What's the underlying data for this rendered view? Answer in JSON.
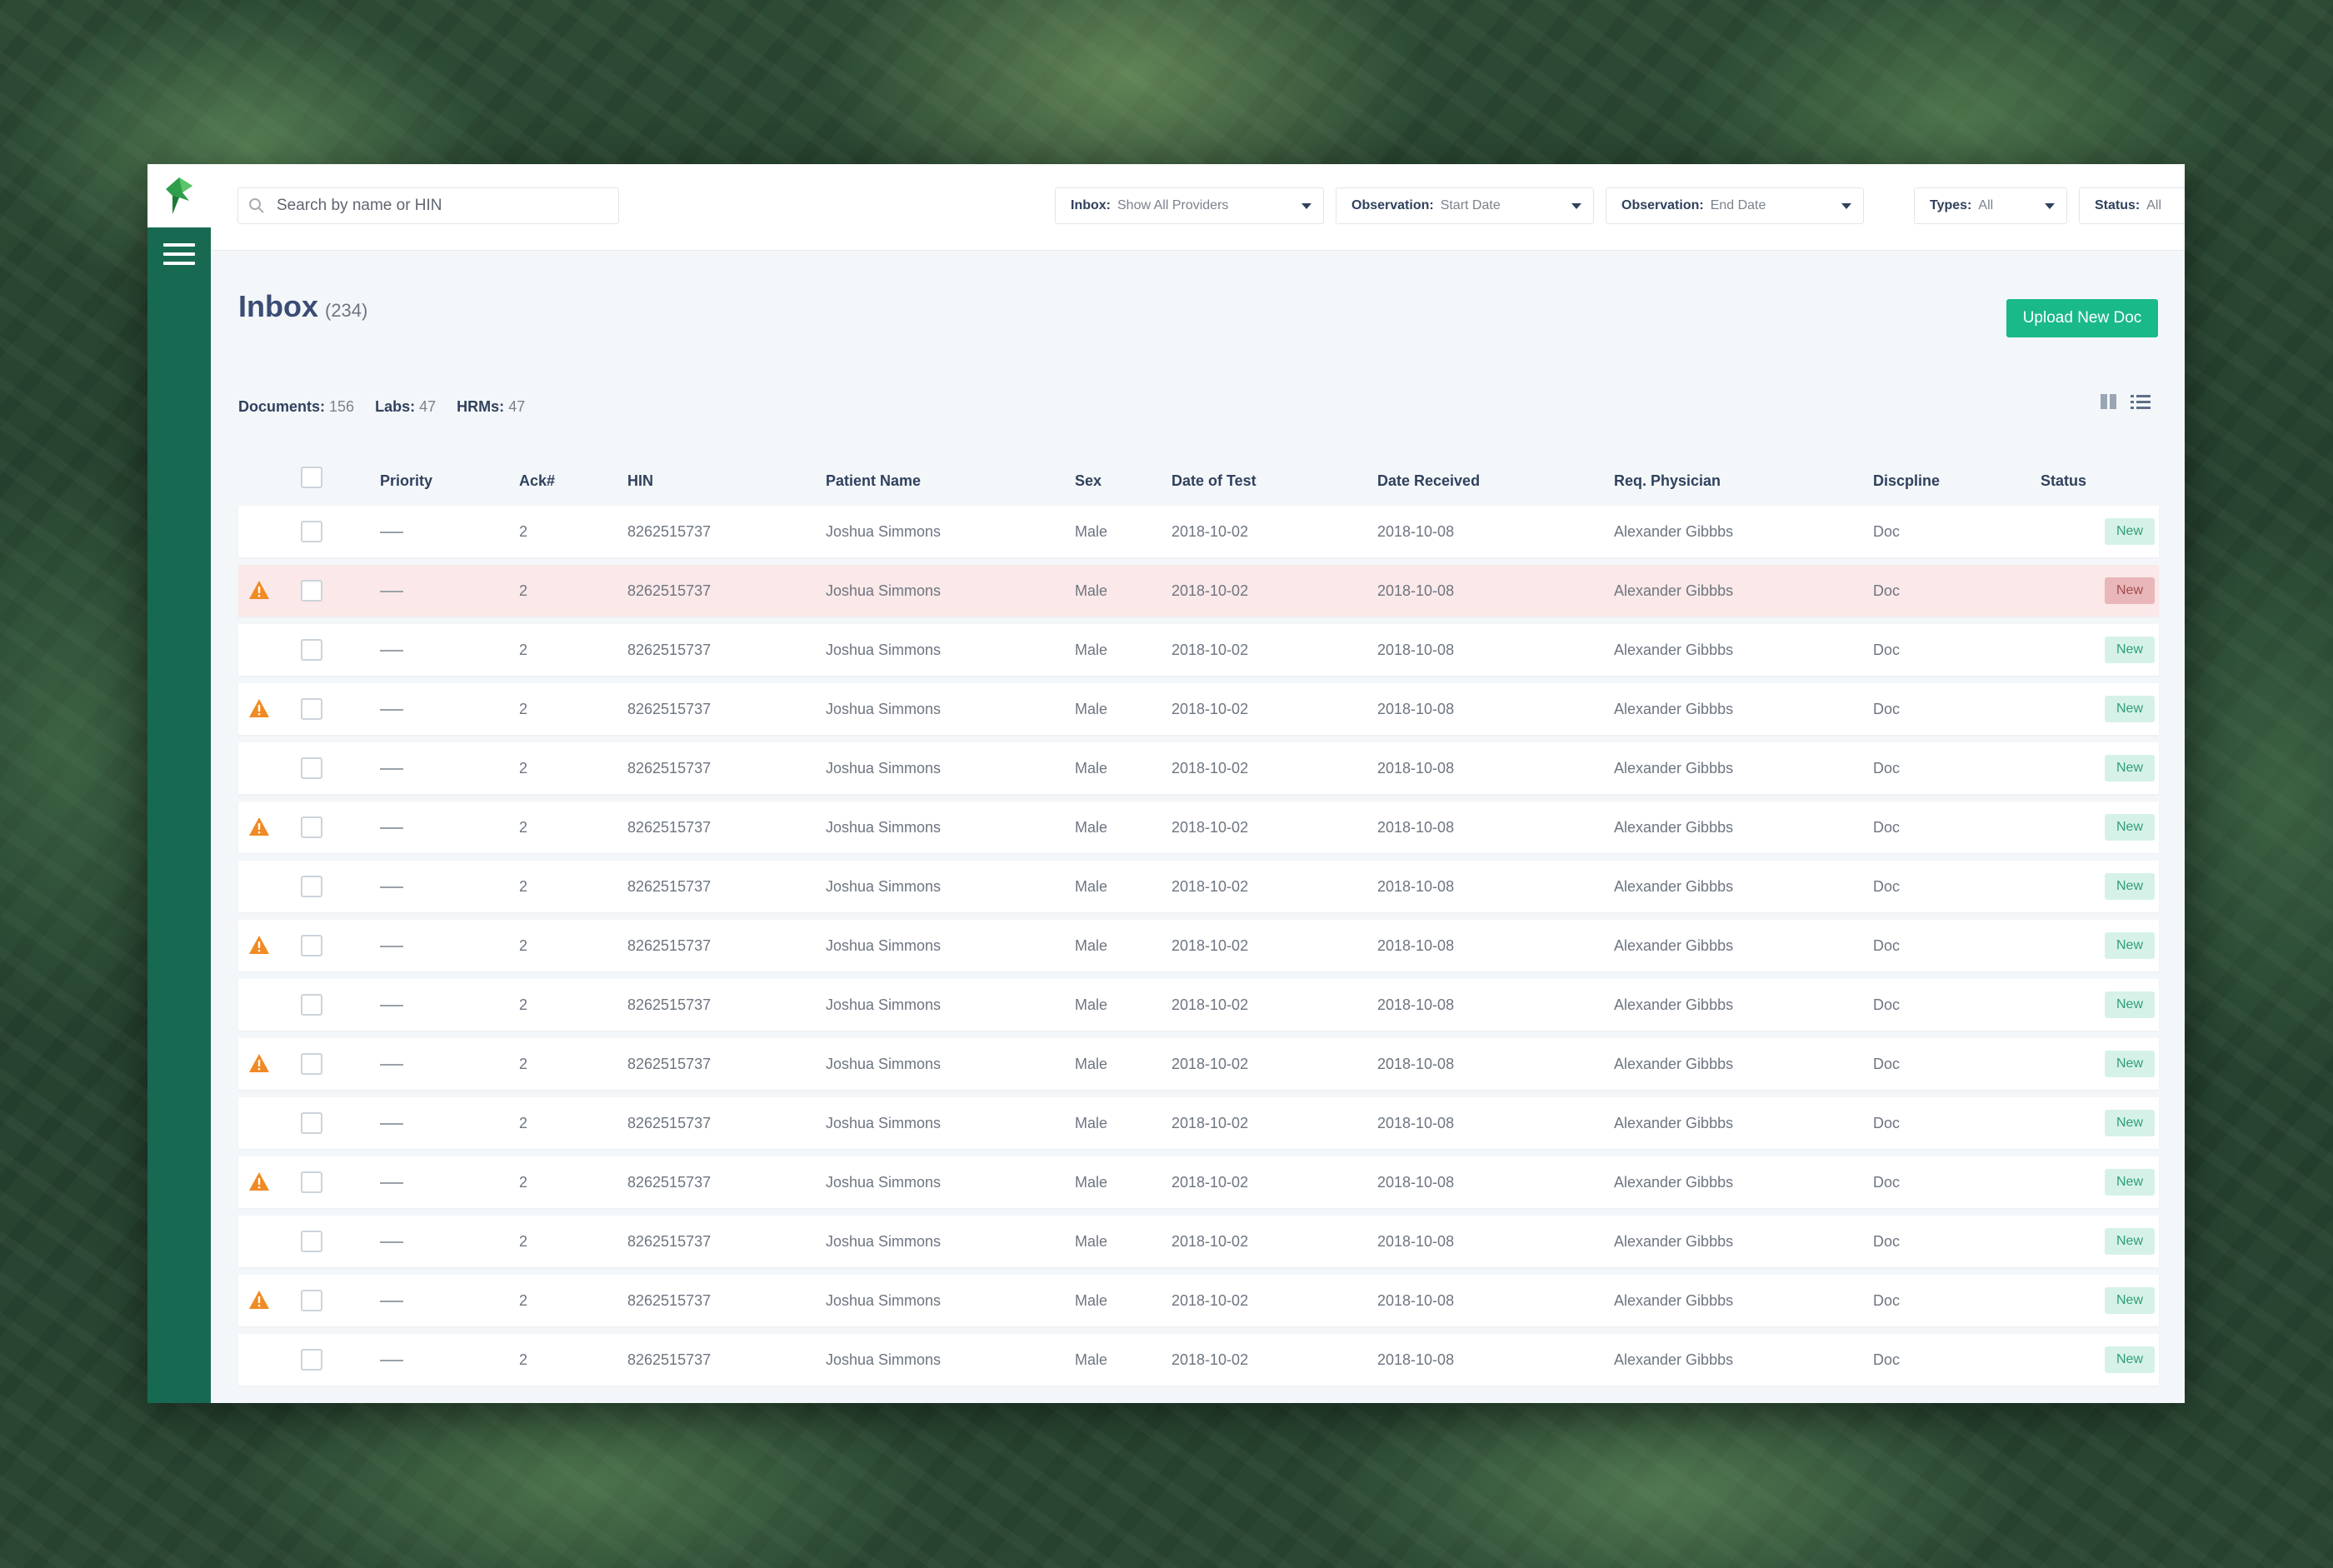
{
  "topbar": {
    "search_placeholder": "Search by name or HIN",
    "filters": [
      {
        "label": "Inbox:",
        "value": "Show All Providers"
      },
      {
        "label": "Observation:",
        "value": "Start Date"
      },
      {
        "label": "Observation:",
        "value": "End Date"
      },
      {
        "label": "Types:",
        "value": "All"
      },
      {
        "label": "Status:",
        "value": "All"
      }
    ]
  },
  "page": {
    "title": "Inbox",
    "count": "(234)",
    "upload_label": "Upload New Doc"
  },
  "summary": {
    "documents_label": "Documents:",
    "documents_value": "156",
    "labs_label": "Labs:",
    "labs_value": "47",
    "hrms_label": "HRMs:",
    "hrms_value": "47"
  },
  "table": {
    "headers": [
      "Priority",
      "Ack#",
      "HIN",
      "Patient Name",
      "Sex",
      "Date of Test",
      "Date Received",
      "Req. Physician",
      "Discpline",
      "Status"
    ],
    "rows": [
      {
        "warning": false,
        "highlight": false,
        "ack": "2",
        "hin": "8262515737",
        "name": "Joshua Simmons",
        "sex": "Male",
        "date_test": "2018-10-02",
        "date_received": "2018-10-08",
        "physician": "Alexander Gibbbs",
        "discipline": "Doc",
        "status": "New"
      },
      {
        "warning": true,
        "highlight": true,
        "ack": "2",
        "hin": "8262515737",
        "name": "Joshua Simmons",
        "sex": "Male",
        "date_test": "2018-10-02",
        "date_received": "2018-10-08",
        "physician": "Alexander Gibbbs",
        "discipline": "Doc",
        "status": "New"
      },
      {
        "warning": false,
        "highlight": false,
        "ack": "2",
        "hin": "8262515737",
        "name": "Joshua Simmons",
        "sex": "Male",
        "date_test": "2018-10-02",
        "date_received": "2018-10-08",
        "physician": "Alexander Gibbbs",
        "discipline": "Doc",
        "status": "New"
      },
      {
        "warning": true,
        "highlight": false,
        "ack": "2",
        "hin": "8262515737",
        "name": "Joshua Simmons",
        "sex": "Male",
        "date_test": "2018-10-02",
        "date_received": "2018-10-08",
        "physician": "Alexander Gibbbs",
        "discipline": "Doc",
        "status": "New"
      },
      {
        "warning": false,
        "highlight": false,
        "ack": "2",
        "hin": "8262515737",
        "name": "Joshua Simmons",
        "sex": "Male",
        "date_test": "2018-10-02",
        "date_received": "2018-10-08",
        "physician": "Alexander Gibbbs",
        "discipline": "Doc",
        "status": "New"
      },
      {
        "warning": true,
        "highlight": false,
        "ack": "2",
        "hin": "8262515737",
        "name": "Joshua Simmons",
        "sex": "Male",
        "date_test": "2018-10-02",
        "date_received": "2018-10-08",
        "physician": "Alexander Gibbbs",
        "discipline": "Doc",
        "status": "New"
      },
      {
        "warning": false,
        "highlight": false,
        "ack": "2",
        "hin": "8262515737",
        "name": "Joshua Simmons",
        "sex": "Male",
        "date_test": "2018-10-02",
        "date_received": "2018-10-08",
        "physician": "Alexander Gibbbs",
        "discipline": "Doc",
        "status": "New"
      },
      {
        "warning": true,
        "highlight": false,
        "ack": "2",
        "hin": "8262515737",
        "name": "Joshua Simmons",
        "sex": "Male",
        "date_test": "2018-10-02",
        "date_received": "2018-10-08",
        "physician": "Alexander Gibbbs",
        "discipline": "Doc",
        "status": "New"
      },
      {
        "warning": false,
        "highlight": false,
        "ack": "2",
        "hin": "8262515737",
        "name": "Joshua Simmons",
        "sex": "Male",
        "date_test": "2018-10-02",
        "date_received": "2018-10-08",
        "physician": "Alexander Gibbbs",
        "discipline": "Doc",
        "status": "New"
      },
      {
        "warning": true,
        "highlight": false,
        "ack": "2",
        "hin": "8262515737",
        "name": "Joshua Simmons",
        "sex": "Male",
        "date_test": "2018-10-02",
        "date_received": "2018-10-08",
        "physician": "Alexander Gibbbs",
        "discipline": "Doc",
        "status": "New"
      },
      {
        "warning": false,
        "highlight": false,
        "ack": "2",
        "hin": "8262515737",
        "name": "Joshua Simmons",
        "sex": "Male",
        "date_test": "2018-10-02",
        "date_received": "2018-10-08",
        "physician": "Alexander Gibbbs",
        "discipline": "Doc",
        "status": "New"
      },
      {
        "warning": true,
        "highlight": false,
        "ack": "2",
        "hin": "8262515737",
        "name": "Joshua Simmons",
        "sex": "Male",
        "date_test": "2018-10-02",
        "date_received": "2018-10-08",
        "physician": "Alexander Gibbbs",
        "discipline": "Doc",
        "status": "New"
      },
      {
        "warning": false,
        "highlight": false,
        "ack": "2",
        "hin": "8262515737",
        "name": "Joshua Simmons",
        "sex": "Male",
        "date_test": "2018-10-02",
        "date_received": "2018-10-08",
        "physician": "Alexander Gibbbs",
        "discipline": "Doc",
        "status": "New"
      },
      {
        "warning": true,
        "highlight": false,
        "ack": "2",
        "hin": "8262515737",
        "name": "Joshua Simmons",
        "sex": "Male",
        "date_test": "2018-10-02",
        "date_received": "2018-10-08",
        "physician": "Alexander Gibbbs",
        "discipline": "Doc",
        "status": "New"
      },
      {
        "warning": false,
        "highlight": false,
        "ack": "2",
        "hin": "8262515737",
        "name": "Joshua Simmons",
        "sex": "Male",
        "date_test": "2018-10-02",
        "date_received": "2018-10-08",
        "physician": "Alexander Gibbbs",
        "discipline": "Doc",
        "status": "New"
      }
    ]
  },
  "icons": {
    "logo": "app-logo",
    "menu": "hamburger-menu-icon",
    "search": "search-icon",
    "warning": "warning-icon",
    "grid_view": "grid-view-icon",
    "list_view": "list-view-icon"
  },
  "colors": {
    "sidebar": "#176a51",
    "accent": "#19b98a",
    "warning": "#f08a24",
    "highlight_row": "#fbe8e8"
  }
}
